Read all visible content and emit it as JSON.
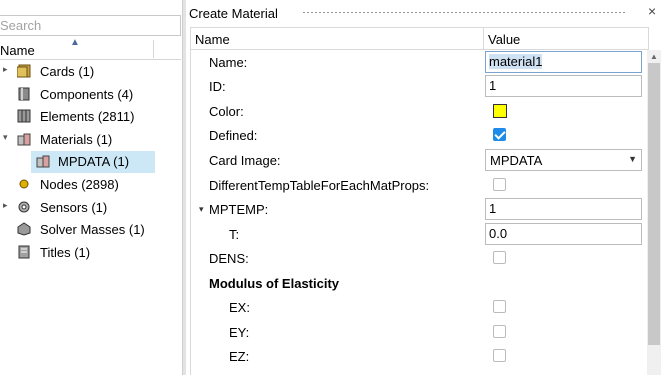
{
  "search": {
    "placeholder": "Search"
  },
  "tree": {
    "header": "Name",
    "items": [
      {
        "label": "Cards",
        "count": "(1)",
        "icon": "cards-icon",
        "expandable": true
      },
      {
        "label": "Components",
        "count": "(4)",
        "icon": "components-icon",
        "expandable": false
      },
      {
        "label": "Elements",
        "count": "(2811)",
        "icon": "elements-icon",
        "expandable": false
      },
      {
        "label": "Materials",
        "count": "(1)",
        "icon": "materials-icon",
        "expandable": true,
        "expanded": true
      },
      {
        "label": "MPDATA",
        "count": "(1)",
        "icon": "material-item-icon",
        "child": true,
        "selected": true
      },
      {
        "label": "Nodes",
        "count": "(2898)",
        "icon": "nodes-icon",
        "expandable": false
      },
      {
        "label": "Sensors",
        "count": "(1)",
        "icon": "sensors-icon",
        "expandable": true
      },
      {
        "label": "Solver Masses",
        "count": "(1)",
        "icon": "solver-masses-icon",
        "expandable": false
      },
      {
        "label": "Titles",
        "count": "(1)",
        "icon": "titles-icon",
        "expandable": false
      }
    ]
  },
  "panel": {
    "title": "Create Material",
    "close": "×",
    "col_name": "Name",
    "col_value": "Value",
    "rows": {
      "name": {
        "label": "Name:",
        "value": "material1"
      },
      "id": {
        "label": "ID:",
        "value": "1"
      },
      "color": {
        "label": "Color:",
        "value_color": "#ffff00"
      },
      "defined": {
        "label": "Defined:",
        "checked": true
      },
      "card_image": {
        "label": "Card Image:",
        "value": "MPDATA"
      },
      "diff_temp": {
        "label": "DifferentTempTableForEachMatProps:",
        "checked": false
      },
      "mptemp": {
        "label": "MPTEMP:",
        "value": "1"
      },
      "t": {
        "label": "T:",
        "value": "0.0"
      },
      "dens": {
        "label": "DENS:",
        "checked": false
      },
      "modulus": {
        "label": "Modulus of Elasticity"
      },
      "ex": {
        "label": "EX:",
        "checked": false
      },
      "ey": {
        "label": "EY:",
        "checked": false
      },
      "ez": {
        "label": "EZ:",
        "checked": false
      }
    }
  },
  "colors": {
    "selection": "#cce8f6",
    "checkbox_accent": "#1e8be8"
  }
}
